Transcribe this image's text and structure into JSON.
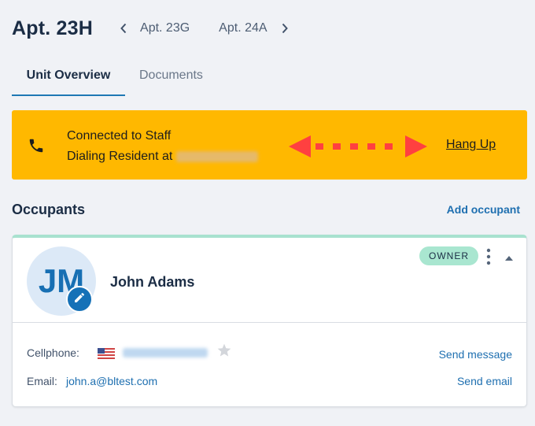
{
  "header": {
    "title": "Apt. 23H",
    "prev_unit": "Apt. 23G",
    "next_unit": "Apt. 24A"
  },
  "tabs": [
    {
      "label": "Unit Overview",
      "active": true
    },
    {
      "label": "Documents",
      "active": false
    }
  ],
  "call_banner": {
    "line1": "Connected to Staff",
    "line2_prefix": "Dialing Resident at",
    "hangup_label": "Hang Up",
    "color": "#ffb800",
    "icon": "phone-icon"
  },
  "occupants": {
    "title": "Occupants",
    "add_label": "Add occupant",
    "list": [
      {
        "initials": "JM",
        "name": "John Adams",
        "role_badge": "OWNER",
        "cellphone_label": "Cellphone:",
        "email_label": "Email:",
        "email": "john.a@bltest.com",
        "send_message_label": "Send message",
        "send_email_label": "Send email"
      }
    ]
  },
  "colors": {
    "accent": "#1e6fb0",
    "banner": "#ffb800",
    "owner_badge": "#a9e6d0",
    "arrow": "#ff4040"
  }
}
